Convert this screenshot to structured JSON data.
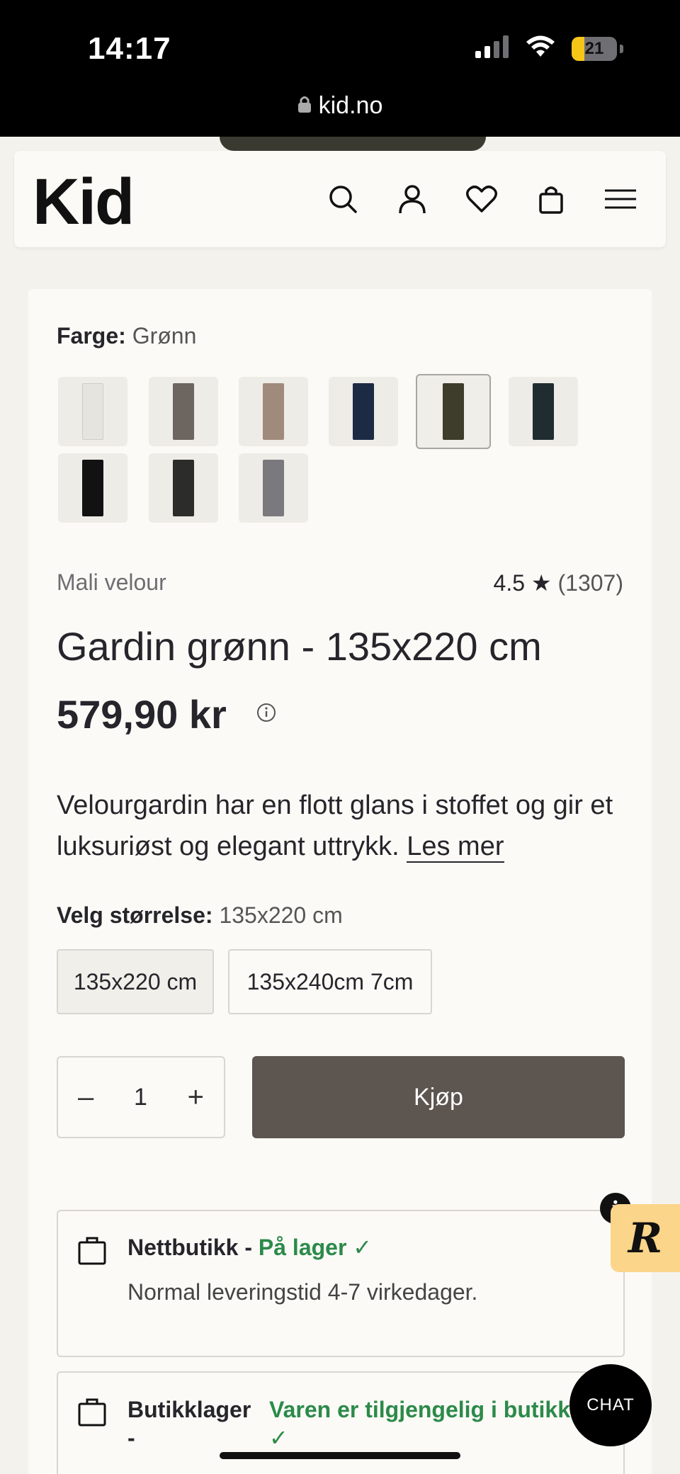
{
  "status": {
    "time": "14:17",
    "battery": "21",
    "url": "kid.no"
  },
  "brand": {
    "logo": "Kid"
  },
  "header_icons": [
    "search-icon",
    "user-icon",
    "heart-icon",
    "bag-icon",
    "menu-icon"
  ],
  "product": {
    "color_label": "Farge:",
    "color_value": "Grønn",
    "swatches": [
      {
        "name": "white",
        "color": "#e6e4df"
      },
      {
        "name": "taupe",
        "color": "#6c6560"
      },
      {
        "name": "beige",
        "color": "#a08a7c"
      },
      {
        "name": "navy",
        "color": "#1d2a44"
      },
      {
        "name": "green",
        "color": "#3e3d2c",
        "selected": true
      },
      {
        "name": "petrol",
        "color": "#1f2d31"
      },
      {
        "name": "black",
        "color": "#121212"
      },
      {
        "name": "darkgrey",
        "color": "#2c2c2a"
      },
      {
        "name": "grey",
        "color": "#7a7a7e"
      }
    ],
    "series": "Mali velour",
    "rating": "4.5 ★",
    "rating_count": "(1307)",
    "title": "Gardin grønn - 135x220 cm",
    "price": "579,90 kr",
    "description": "Velourgardin har en flott glans i stoffet og gir et luksuriøst og elegant uttrykk.",
    "read_more": "Les mer",
    "size_label": "Velg størrelse:",
    "size_value": "135x220 cm",
    "sizes": [
      "135x220 cm",
      "135x240cm 7cm"
    ],
    "quantity": "1",
    "qty_minus": "–",
    "qty_plus": "+",
    "buy_label": "Kjøp"
  },
  "stock": {
    "online_title": "Nettbutikk - ",
    "online_status": "På lager ✓",
    "online_note": "Normal leveringstid 4-7 virkedager.",
    "store_title": "Butikklager -",
    "store_status": "Varen er tilgjengelig i butikk ✓"
  },
  "widgets": {
    "chat": "CHAT",
    "info": "i",
    "reviews": "R"
  },
  "colors": {
    "buy_button": "#5c5550",
    "in_stock": "#2c8a4a",
    "reviews_badge": "#fbd589"
  }
}
